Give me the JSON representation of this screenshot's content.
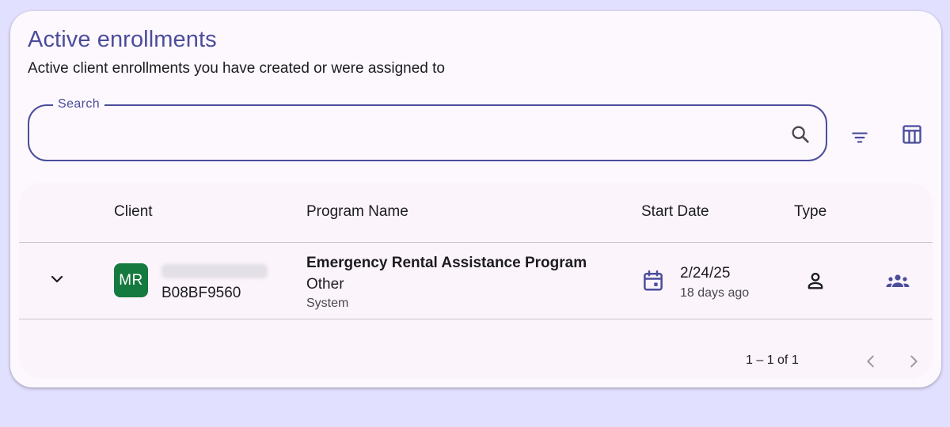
{
  "header": {
    "title": "Active enrollments",
    "subtitle": "Active client enrollments you have created or were assigned to"
  },
  "search": {
    "label": "Search",
    "value": "",
    "icon": "search-icon"
  },
  "toolbar": {
    "filter_icon": "filter-icon",
    "columns_icon": "view-columns-icon"
  },
  "table": {
    "columns": [
      "Client",
      "Program Name",
      "Start Date",
      "Type"
    ],
    "rows": [
      {
        "client_initials": "MR",
        "client_id": "B08BF9560",
        "program_name": "Emergency Rental Assistance Program",
        "program_type": "Other",
        "program_source": "System",
        "start_date": "2/24/25",
        "start_relative": "18 days ago",
        "type_icon": "person-icon",
        "action_icon": "group-icon"
      }
    ]
  },
  "pagination": {
    "range_text": "1 – 1 of 1"
  },
  "colors": {
    "accent": "#4b4d9b",
    "avatar": "#157a3f",
    "page_background": "#e2e0ff",
    "card_background": "#fdf8fd"
  }
}
